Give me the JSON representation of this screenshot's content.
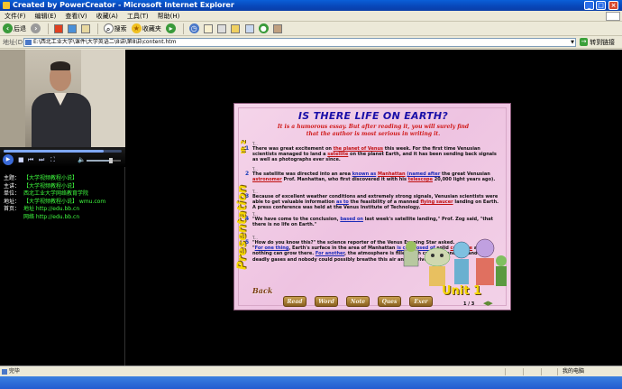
{
  "window": {
    "title": "Created by PowerCreator - Microsoft Internet Explorer"
  },
  "menu": [
    "文件(F)",
    "编辑(E)",
    "查看(V)",
    "收藏(A)",
    "工具(T)",
    "帮助(H)"
  ],
  "toolbar": {
    "back": "后退",
    "search": "搜索",
    "favorites": "收藏夹"
  },
  "address": {
    "label": "地址(D)",
    "value": "E:\\西北工业大学\\课件\\大学英语二\\8讲\\第8讲\\content.htm",
    "go": "转到",
    "links": "链接"
  },
  "player": {
    "progress_pct": 85,
    "volume_pct": 70
  },
  "info": [
    {
      "key": "主题：",
      "value": "【大学视频教程小说】"
    },
    {
      "key": "主讲：",
      "value": "【大学视频教程小说】"
    },
    {
      "key": "单位：",
      "value": "西北工业大学网络教育学院"
    },
    {
      "key": "地址：",
      "value": "【大学视频教程小说】 wmu.com"
    },
    {
      "key": "首页：",
      "value": "地址 http://edu.bb.cn"
    },
    {
      "key": "",
      "value": "网络 http://edu.bb.cn"
    }
  ],
  "slide": {
    "title": "IS THERE LIFE ON EARTH?",
    "subtitle_1": "It is a humorous essay. But after reading it, you will surely find",
    "subtitle_2": "that the author is most serious in writing it.",
    "side_label": "Presentation",
    "side_code": "IR 2",
    "speaker_label": "T...",
    "paragraphs": [
      {
        "num": "1",
        "parts": [
          "There was great excitement on ",
          "the planet of Venus",
          " this week. For the first time Venusian scientists managed to land a ",
          "satellite",
          " on the planet Earth, and it has been sending back signals as well as photographs ever since."
        ]
      },
      {
        "num": "2",
        "parts": [
          "The satellite was directed into an area ",
          "known as",
          " ",
          "Manhattan",
          " ",
          "(named after",
          " the great Venusian ",
          "astronomer",
          " Prof. Manhattan, who first discovered it with his ",
          "telescope",
          " 20,000 light years ago)."
        ]
      },
      {
        "num": "3",
        "parts": [
          "Because of excellent weather conditions and extremely strong signals, Venusian scientists were able to get valuable information ",
          "as to",
          " the feasibility of a manned ",
          "flying saucer",
          " landing on Earth. A press conference was held at the Venus Institute of Technology."
        ]
      },
      {
        "num": "4",
        "parts": [
          "\"We have come to the conclusion, ",
          "based on",
          " last week's satellite landing,\" Prof. Zog said, \"that there is no life on Earth.\""
        ]
      },
      {
        "num": "5",
        "parts": [
          "\"How do you know this?\" the science reporter of the Venus Evening Star asked.",
          "\"",
          "For one thing",
          ", Earth's surface in the area of Manhattan ",
          "is composed of",
          " solid ",
          "concrete",
          " and nothing can grow there. ",
          "For another",
          ", the atmosphere is filled with carbon monoxide and other deadly gases and nobody could possibly breathe this air and survive.\""
        ]
      }
    ],
    "back_label": "Back",
    "unit_label": "Unit 1",
    "nav_buttons": [
      "Read",
      "Word",
      "Note",
      "Ques",
      "Exer"
    ],
    "page_indicator": "1 / 3"
  },
  "status": {
    "left": "完毕",
    "zone": "我的电脑"
  },
  "colors": {
    "accent_red": "#c01010",
    "accent_blue": "#1a2ab8",
    "title_blue": "#1a0fa8",
    "label_yellow": "#f5d700"
  }
}
